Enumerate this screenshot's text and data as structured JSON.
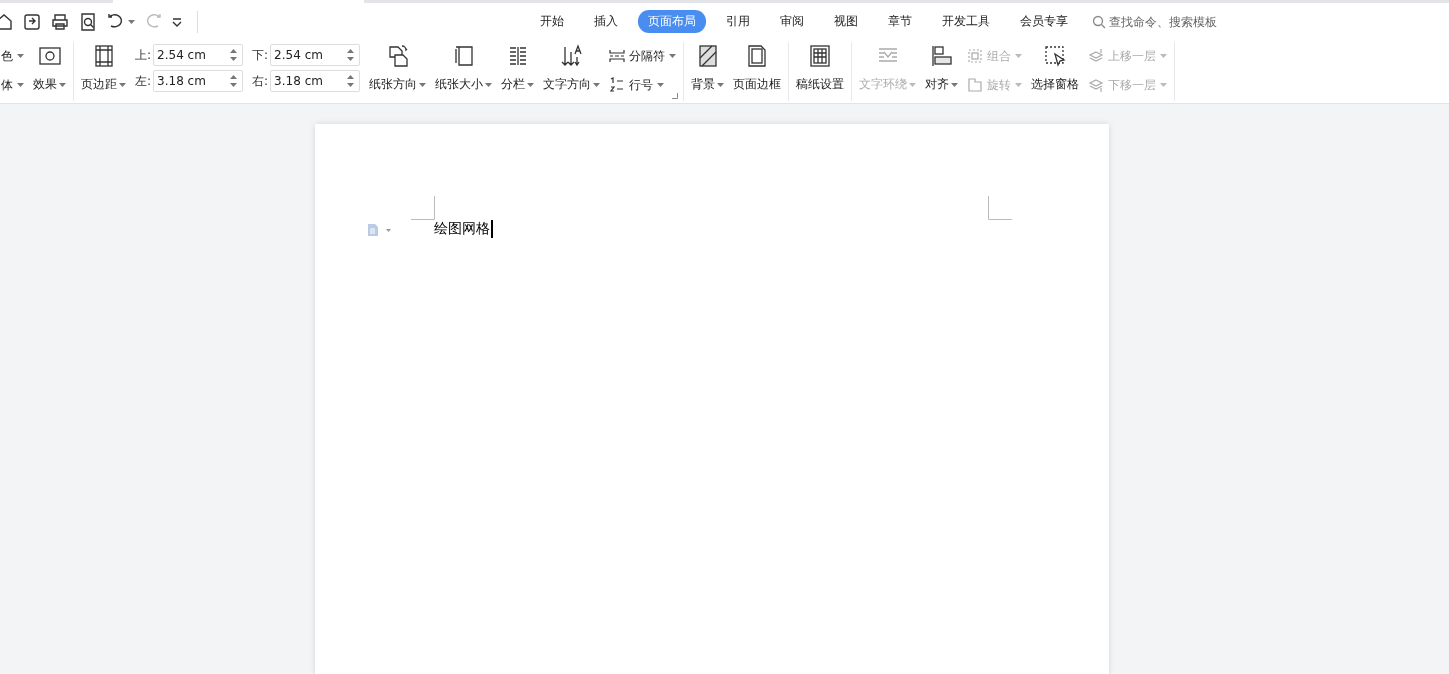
{
  "quick_access": [
    {
      "disabled": false
    },
    {
      "disabled": false
    },
    {
      "disabled": false
    },
    {
      "disabled": false
    },
    {
      "disabled": false
    },
    {
      "disabled": true
    },
    {
      "disabled": false
    }
  ],
  "tabs": [
    {
      "label": "开始",
      "selected": false
    },
    {
      "label": "插入",
      "selected": false
    },
    {
      "label": "页面布局",
      "selected": true
    },
    {
      "label": "引用",
      "selected": false
    },
    {
      "label": "审阅",
      "selected": false
    },
    {
      "label": "视图",
      "selected": false
    },
    {
      "label": "章节",
      "selected": false
    },
    {
      "label": "开发工具",
      "selected": false
    },
    {
      "label": "会员专享",
      "selected": false
    }
  ],
  "search": {
    "placeholder": "查找命令、搜索模板"
  },
  "ribbon": [
    {
      "launcher": false,
      "columns": [
        {
          "kind": "stack",
          "items": [
            {
              "label": "色",
              "dropdown": true,
              "disabled": false
            },
            {
              "label": "体",
              "dropdown": true,
              "disabled": false
            }
          ]
        },
        {
          "kind": "large",
          "label": "效果",
          "dropdown": true,
          "disabled": false
        }
      ]
    },
    {
      "launcher": true,
      "columns": [
        {
          "kind": "large",
          "label": "页边距",
          "dropdown": true,
          "disabled": false
        },
        {
          "kind": "fields",
          "items": [
            {
              "label": "上:",
              "value": "2.54 cm"
            },
            {
              "label": "左:",
              "value": "3.18 cm"
            }
          ]
        },
        {
          "kind": "fields",
          "items": [
            {
              "label": "下:",
              "value": "2.54 cm"
            },
            {
              "label": "右:",
              "value": "3.18 cm"
            }
          ]
        },
        {
          "kind": "large",
          "label": "纸张方向",
          "dropdown": true,
          "disabled": false
        },
        {
          "kind": "large",
          "label": "纸张大小",
          "dropdown": true,
          "disabled": false
        },
        {
          "kind": "large",
          "label": "分栏",
          "dropdown": true,
          "disabled": false
        },
        {
          "kind": "large",
          "label": "文字方向",
          "dropdown": true,
          "disabled": false
        },
        {
          "kind": "stack",
          "items": [
            {
              "label": "分隔符",
              "dropdown": true,
              "disabled": false
            },
            {
              "label": "行号",
              "dropdown": true,
              "disabled": false
            }
          ]
        }
      ]
    },
    {
      "launcher": false,
      "columns": [
        {
          "kind": "large",
          "label": "背景",
          "dropdown": true,
          "disabled": false
        },
        {
          "kind": "large",
          "label": "页面边框",
          "dropdown": false,
          "disabled": false
        }
      ]
    },
    {
      "launcher": false,
      "columns": [
        {
          "kind": "large",
          "label": "稿纸设置",
          "dropdown": false,
          "disabled": false
        }
      ]
    },
    {
      "launcher": false,
      "columns": [
        {
          "kind": "large",
          "label": "文字环绕",
          "dropdown": true,
          "disabled": true
        },
        {
          "kind": "large",
          "label": "对齐",
          "dropdown": true,
          "disabled": false
        },
        {
          "kind": "stack",
          "items": [
            {
              "label": "组合",
              "dropdown": true,
              "disabled": true
            },
            {
              "label": "旋转",
              "dropdown": true,
              "disabled": true
            }
          ]
        },
        {
          "kind": "large",
          "label": "选择窗格",
          "dropdown": false,
          "disabled": false
        },
        {
          "kind": "stack",
          "items": [
            {
              "label": "上移一层",
              "dropdown": true,
              "disabled": true
            },
            {
              "label": "下移一层",
              "dropdown": true,
              "disabled": true
            }
          ]
        }
      ]
    }
  ],
  "document": {
    "text": "绘图网格"
  }
}
